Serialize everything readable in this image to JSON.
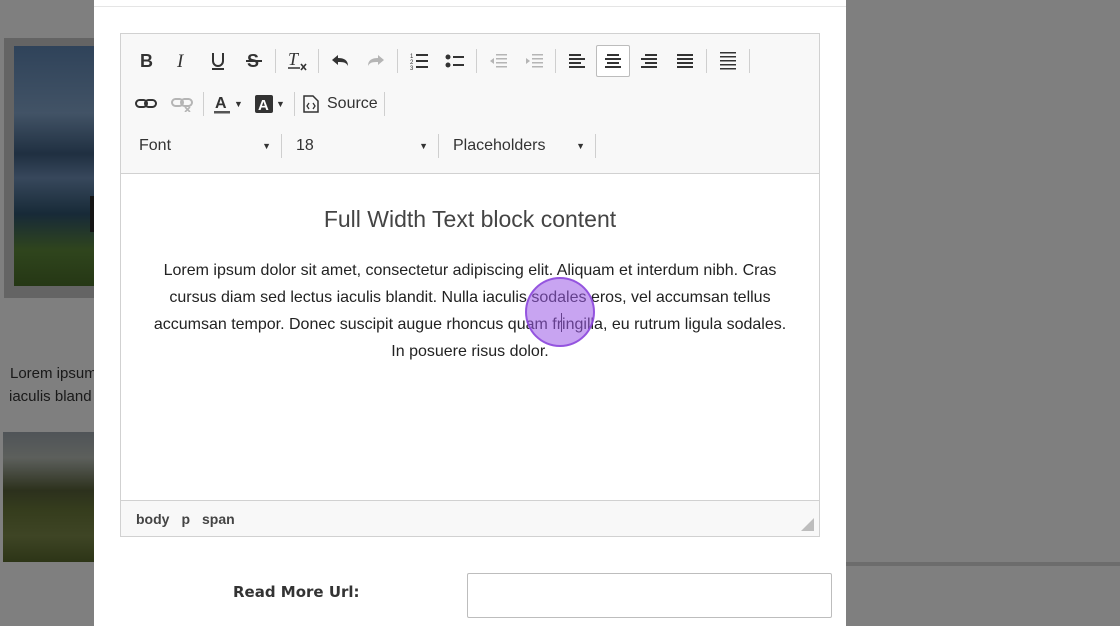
{
  "background": {
    "text_line1": "Lorem ipsum",
    "text_line2": "iaculis bland"
  },
  "toolbar": {
    "bold_icon": "bold-icon",
    "italic_icon": "italic-icon",
    "underline_icon": "underline-icon",
    "strike_icon": "strikethrough-icon",
    "remove_format_icon": "remove-format-icon",
    "undo_icon": "undo-icon",
    "redo_icon": "redo-icon",
    "numbered_list_icon": "numbered-list-icon",
    "bulleted_list_icon": "bulleted-list-icon",
    "outdent_icon": "outdent-icon",
    "indent_icon": "indent-icon",
    "align_left_icon": "align-left-icon",
    "align_center_icon": "align-center-icon",
    "align_right_icon": "align-right-icon",
    "justify_icon": "justify-icon",
    "block_icon": "horizontal-lines-icon",
    "link_icon": "link-icon",
    "unlink_icon": "unlink-icon",
    "text_color_icon": "text-color-icon",
    "bg_color_icon": "background-color-icon",
    "source_label": "Source",
    "font_label": "Font",
    "size_value": "18",
    "placeholders_label": "Placeholders",
    "active_alignment": "center"
  },
  "content": {
    "heading": "Full Width Text block content",
    "paragraph": "Lorem ipsum dolor sit amet, consectetur adipiscing elit. Aliquam et interdum nibh. Cras cursus diam sed lectus iaculis blandit. Nulla iaculis sodales eros, vel accumsan tellus accumsan tempor. Donec suscipit augue rhoncus quam fringilla, eu rutrum ligula sodales. In posuere risus dolor."
  },
  "statusbar": {
    "crumbs": [
      "body",
      "p",
      "span"
    ]
  },
  "form": {
    "read_more_label": "Read More Url:",
    "read_more_value": ""
  },
  "colors": {
    "click_highlight": "#9b5ae6",
    "overlay": "#000000"
  }
}
